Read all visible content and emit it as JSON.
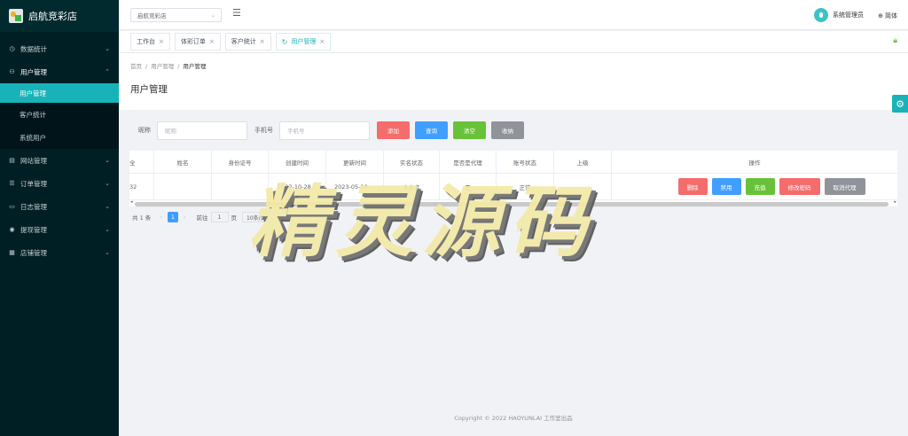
{
  "brand": {
    "title": "启航竞彩店"
  },
  "sidebar": {
    "items": [
      {
        "label": "数据统计",
        "icon": "◷"
      },
      {
        "label": "用户管理",
        "icon": "⚇"
      },
      {
        "label": "网站管理",
        "icon": "▤"
      },
      {
        "label": "订单管理",
        "icon": "☰"
      },
      {
        "label": "日志管理",
        "icon": "▭"
      },
      {
        "label": "提现管理",
        "icon": "◉"
      },
      {
        "label": "店铺管理",
        "icon": "▦"
      }
    ],
    "sub_items": [
      {
        "label": "用户管理"
      },
      {
        "label": "客户统计"
      },
      {
        "label": "系统用户"
      }
    ]
  },
  "header": {
    "store_select": "启航竞彩店",
    "user_name": "系统管理员",
    "lang": "简体"
  },
  "tabs": [
    {
      "label": "工作台"
    },
    {
      "label": "体彩订单"
    },
    {
      "label": "客户统计"
    },
    {
      "label": "用户管理"
    }
  ],
  "breadcrumb": {
    "home": "首页",
    "level1": "用户管理",
    "level2": "用户管理"
  },
  "page_title": "用户管理",
  "search": {
    "nickname_label": "昵称",
    "nickname_placeholder": "昵称",
    "phone_label": "手机号",
    "phone_placeholder": "手机号",
    "add": "添加",
    "query": "查询",
    "clear": "清空",
    "collapse": "收纳"
  },
  "table": {
    "headers": [
      "全",
      "姓名",
      "身份证号",
      "创建时间",
      "更新时间",
      "实名状态",
      "是否是代理",
      "账号状态",
      "上级",
      "操作"
    ],
    "rows": [
      {
        "id": "32",
        "name": "",
        "id_card": "",
        "created": "2022-10-28...",
        "updated": "2023-05-10 ...",
        "realname": "未实名",
        "agent": "是",
        "status": "正常",
        "parent": ""
      }
    ],
    "ops": {
      "delete": "删除",
      "disable": "禁用",
      "recharge": "充值",
      "change_pwd": "修改密码",
      "cancel_agent": "取消代理"
    }
  },
  "pager": {
    "total": "共 1 条",
    "current": "1",
    "goto": "前往",
    "goto_value": "1",
    "page_unit": "页",
    "page_size": "10条/页"
  },
  "watermark": "精灵源码",
  "footer": "Copyright © 2022 HAOYUNLAI 工作室出品"
}
